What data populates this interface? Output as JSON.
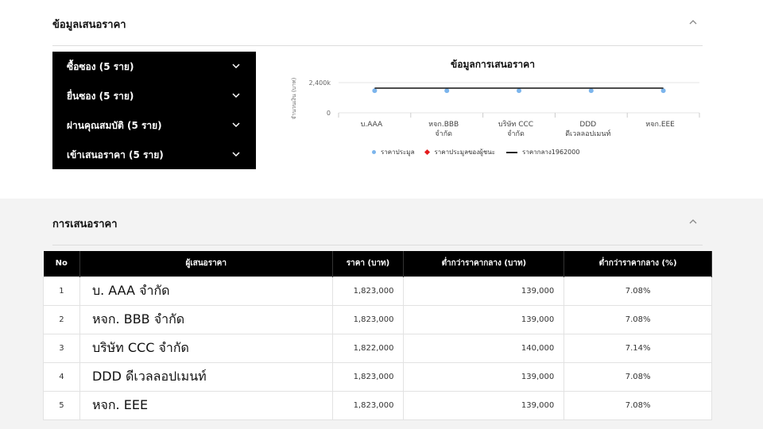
{
  "info_section": {
    "title": "ข้อมูลเสนอราคา",
    "accordion": [
      {
        "label": "ซื้อซอง (5 ราย)"
      },
      {
        "label": "ยื่นซอง (5 ราย)"
      },
      {
        "label": "ผ่านคุณสมบัติ (5 ราย)"
      },
      {
        "label": "เข้าเสนอราคา (5 ราย)"
      }
    ]
  },
  "chart_data": {
    "type": "line",
    "title": "ข้อมูลการเสนอราคา",
    "ylabel": "จำนวนเงิน (บาท)",
    "xlabel": "",
    "y_ticks": [
      "0",
      "2,400k"
    ],
    "ylim": [
      0,
      2400000
    ],
    "categories": [
      [
        "บ.AAA"
      ],
      [
        "หจก.BBB",
        "จำกัด"
      ],
      [
        "บริษัท CCC",
        "จำกัด"
      ],
      [
        "DDD",
        "ดีเวลลอปเมนท์"
      ],
      [
        "หจก.EEE"
      ]
    ],
    "series": [
      {
        "name": "ราคาประมูล",
        "color": "#7cb5ec",
        "values": [
          1823000,
          1823000,
          1822000,
          1823000,
          1823000
        ]
      },
      {
        "name": "ราคาประมูลของผู้ชนะ",
        "color": "#e41a1c",
        "values": []
      },
      {
        "name": "ราคากลาง1962000",
        "color": "#222222",
        "values": [
          1962000,
          1962000,
          1962000,
          1962000,
          1962000
        ]
      }
    ],
    "grid": true,
    "legend": "bottom"
  },
  "bid_section": {
    "title": "การเสนอราคา",
    "columns": [
      "No",
      "ผู้เสนอราคา",
      "ราคา (บาท)",
      "ต่ำกว่าราคากลาง (บาท)",
      "ต่ำกว่าราคากลาง (%)"
    ],
    "rows": [
      {
        "no": "1",
        "name": "บ. AAA จำกัด",
        "price": "1,823,000",
        "diff": "139,000",
        "pct": "7.08%"
      },
      {
        "no": "2",
        "name": "หจก. BBB จำกัด",
        "price": "1,823,000",
        "diff": "139,000",
        "pct": "7.08%"
      },
      {
        "no": "3",
        "name": "บริษัท CCC จำกัด",
        "price": "1,822,000",
        "diff": "140,000",
        "pct": "7.14%"
      },
      {
        "no": "4",
        "name": "DDD ดีเวลลอปเมนท์",
        "price": "1,823,000",
        "diff": "139,000",
        "pct": "7.08%"
      },
      {
        "no": "5",
        "name": "หจก. EEE",
        "price": "1,823,000",
        "diff": "139,000",
        "pct": "7.08%"
      }
    ]
  },
  "icons": {
    "collapse": "chevron-up-icon",
    "expand": "chevron-down-icon"
  }
}
